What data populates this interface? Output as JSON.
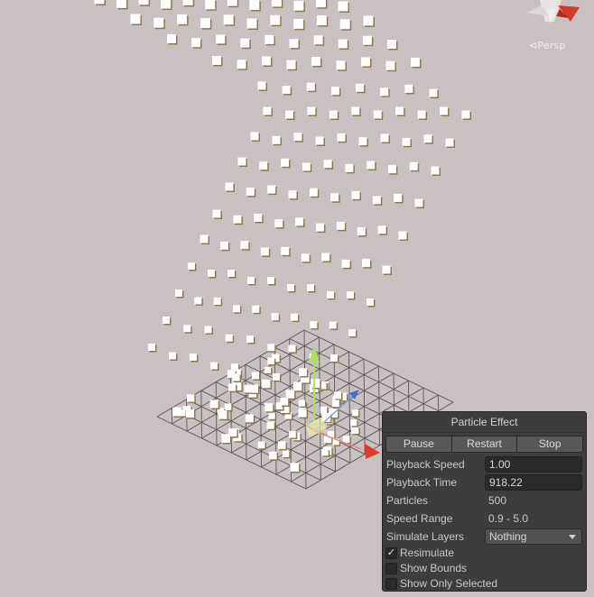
{
  "scene": {
    "perspective_label": "Persp",
    "colors": {
      "background": "#c9c1c1",
      "particle": "#ffffff",
      "particle_shade": "#8a7a52",
      "grid_line": "#5a5656",
      "gizmo_y": "#a8e060",
      "gizmo_z": "#3f6fd0",
      "gizmo_x": "#e23a28"
    },
    "icons": [
      "orientation-gizmo-icon",
      "move-handle-y-icon",
      "move-handle-z-icon",
      "move-handle-x-icon"
    ]
  },
  "panel": {
    "title": "Particle Effect",
    "buttons": {
      "pause": "Pause",
      "restart": "Restart",
      "stop": "Stop"
    },
    "playback_speed": {
      "label": "Playback Speed",
      "value": "1.00"
    },
    "playback_time": {
      "label": "Playback Time",
      "value": "918.22"
    },
    "particles": {
      "label": "Particles",
      "value": "500"
    },
    "speed_range": {
      "label": "Speed Range",
      "value": "0.9 - 5.0"
    },
    "simulate_layers": {
      "label": "Simulate Layers",
      "value": "Nothing"
    },
    "resimulate": {
      "label": "Resimulate",
      "checked": true,
      "mark": "✓"
    },
    "show_bounds": {
      "label": "Show Bounds",
      "checked": false
    },
    "show_only_selected": {
      "label": "Show Only Selected",
      "checked": false
    }
  }
}
